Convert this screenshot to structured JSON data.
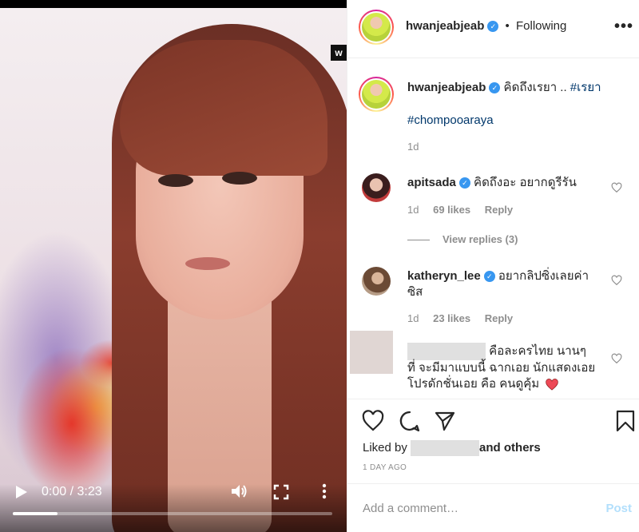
{
  "video": {
    "watermark": "w",
    "time": "0:00 / 3:23",
    "progress": 0.14
  },
  "header": {
    "username": "hwanjeabjeab",
    "separator": "•",
    "follow_status": "Following",
    "more": "•••"
  },
  "caption": {
    "username": "hwanjeabjeab",
    "text": "คิดถึงเรยา .. ",
    "hashtag1": "#เรยา",
    "hashtag2": "#chompooaraya",
    "time": "1d"
  },
  "comments": [
    {
      "username": "apitsada",
      "text": "คิดถึงอะ อยากดูรีรัน",
      "time": "1d",
      "likes": "69 likes",
      "reply": "Reply",
      "view_replies": "View replies (3)"
    },
    {
      "username": "katheryn_lee",
      "text": "อยากลิปซิ่งเลยค่า",
      "text2": "ซิส",
      "time": "1d",
      "likes": "23 likes",
      "reply": "Reply"
    },
    {
      "text_line1": "คือละครไทย นานๆ",
      "text_line2": "ที่ จะมีมาแบบนี้ ฉากเอย นักแสดงเอย",
      "text_line3": "โปรดักชั่นเอย คือ คนดูคุ้ม"
    }
  ],
  "actions": {
    "liked_by_prefix": "Liked by",
    "liked_by_suffix": "and others",
    "post_time": "1 DAY AGO",
    "comment_placeholder": "Add a comment…",
    "post_button": "Post"
  },
  "colors": {
    "link": "#00376b",
    "verified": "#3897f0",
    "muted": "#8e8e8e",
    "post_disabled": "#b2dffc",
    "heart_red": "#ed4956"
  }
}
